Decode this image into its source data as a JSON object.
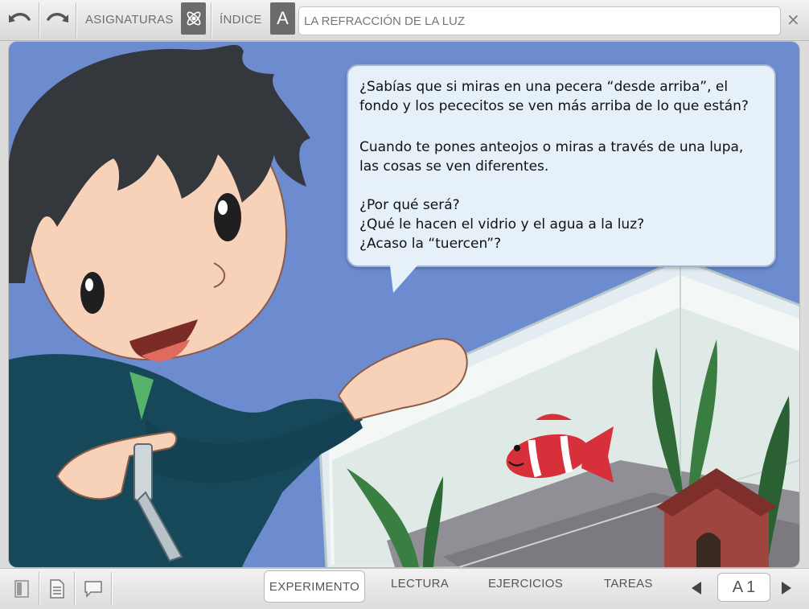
{
  "toolbar": {
    "undo_icon": "undo-arrow-icon",
    "redo_icon": "redo-arrow-icon",
    "subjects_label": "ASIGNATURAS",
    "subjects_icon": "atom-icon",
    "index_label": "ÍNDICE",
    "index_icon_letter": "A",
    "title": "LA REFRACCIÓN DE LA LUZ",
    "close_icon": "×"
  },
  "bubble": {
    "lines": [
      "¿Sabías que si miras en una pecera “desde arriba”, el",
      "fondo y los pececitos se ven más arriba de lo que están?",
      "Cuando te pones anteojos o miras a través de una lupa,",
      "las cosas se ven diferentes.",
      "¿Por qué será?",
      "¿Qué le hacen el vidrio y el agua a la luz?",
      "¿Acaso la “tuercen”?"
    ]
  },
  "bottom": {
    "tabs": [
      "EXPERIMENTO",
      "LECTURA",
      "EJERCICIOS",
      "TAREAS"
    ],
    "active_tab": "EXPERIMENTO",
    "page_letter": "A",
    "page_number": "1"
  },
  "colors": {
    "background": "#6d8ccf",
    "bubble": "#e6f0f9",
    "jacket": "#17485a",
    "fish": "#d7303a"
  }
}
